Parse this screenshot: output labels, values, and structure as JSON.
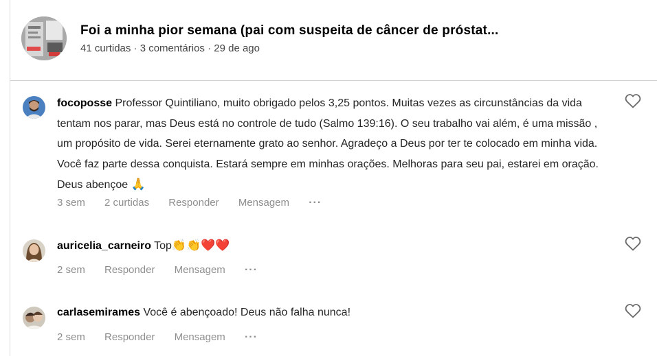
{
  "post": {
    "title": "Foi a minha pior semana (pai com suspeita de câncer de próstat...",
    "meta": "41 curtidas · 3 comentários · 29 de ago"
  },
  "comments": [
    {
      "username": "focoposse",
      "text": "Professor Quintiliano, muito obrigado pelos 3,25 pontos. Muitas vezes as circunstâncias da vida tentam nos parar, mas Deus está no controle de tudo (Salmo 139:16). O seu trabalho vai além, é uma missão , um propósito de vida. Serei eternamente grato ao senhor. Agradeço a Deus por ter te colocado em minha vida. Você faz parte dessa conquista. Estará sempre em minhas orações. Melhoras para seu pai, estarei em oração. Deus abençoe",
      "emoji": "🙏",
      "time": "3 sem",
      "likes": "2 curtidas",
      "reply": "Responder",
      "message": "Mensagem",
      "more": "···"
    },
    {
      "username": "auricelia_carneiro",
      "text": "Top",
      "emoji": "👏👏❤️❤️",
      "time": "2 sem",
      "reply": "Responder",
      "message": "Mensagem",
      "more": "···"
    },
    {
      "username": "carlasemirames",
      "text": "Você é abençoado! Deus não falha nunca!",
      "time": "2 sem",
      "reply": "Responder",
      "message": "Mensagem",
      "more": "···"
    }
  ],
  "colors": {
    "text": "#262626",
    "muted": "#8e8e8e",
    "divider": "#cfcfcf"
  }
}
